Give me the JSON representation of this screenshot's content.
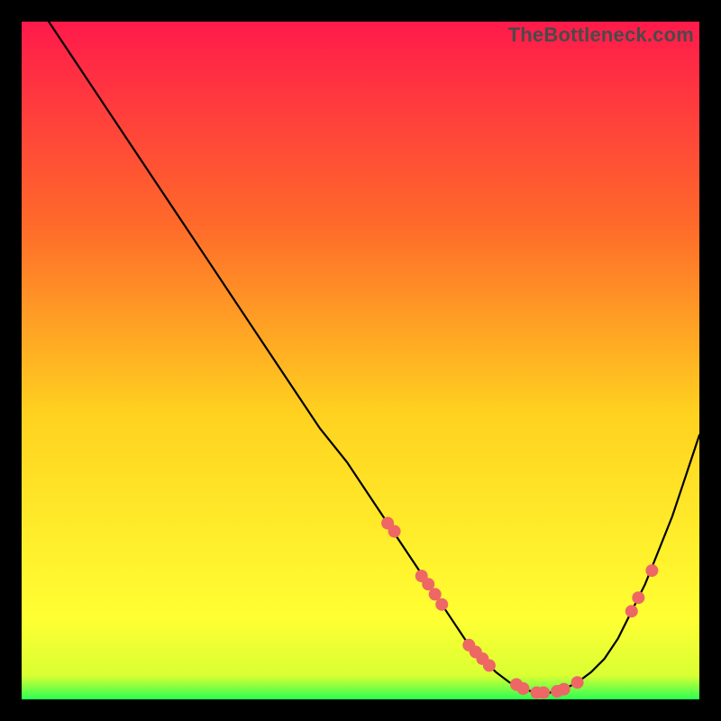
{
  "watermark": "TheBottleneck.com",
  "colors": {
    "grad_top": "#ff1a4b",
    "grad_mid1": "#ff6a2a",
    "grad_mid2": "#ffd21f",
    "grad_mid3": "#ffff33",
    "grad_bot": "#2bff53",
    "curve": "#000000",
    "marker": "#ee6764",
    "frame_bg": "#000000"
  },
  "chart_data": {
    "type": "line",
    "title": "",
    "xlabel": "",
    "ylabel": "",
    "xlim": [
      0,
      100
    ],
    "ylim": [
      0,
      100
    ],
    "series": [
      {
        "name": "bottleneck-curve",
        "x": [
          4,
          8,
          12,
          16,
          20,
          24,
          28,
          32,
          36,
          40,
          44,
          48,
          52,
          54,
          56,
          58,
          60,
          62,
          64,
          66,
          68,
          70,
          72,
          74,
          76,
          78,
          80,
          82,
          84,
          86,
          88,
          90,
          92,
          94,
          96,
          98,
          100
        ],
        "y": [
          100,
          94,
          88,
          82,
          76,
          70,
          64,
          58,
          52,
          46,
          40,
          35,
          29,
          26,
          23,
          20,
          17,
          14,
          11,
          8,
          6,
          4,
          2.5,
          1.5,
          1,
          1,
          1.5,
          2.5,
          4,
          6,
          9,
          13,
          17,
          22,
          27,
          33,
          39
        ]
      }
    ],
    "markers": {
      "name": "highlight-points",
      "x": [
        54,
        55,
        59,
        60,
        61,
        62,
        66,
        67,
        68,
        69,
        73,
        74,
        76,
        77,
        79,
        80,
        82,
        90,
        91,
        93
      ],
      "y": [
        26,
        24.8,
        18.2,
        17,
        15.5,
        14,
        8,
        7,
        6,
        5,
        2.2,
        1.6,
        1,
        1,
        1.2,
        1.5,
        2.5,
        13,
        15,
        19
      ]
    }
  }
}
